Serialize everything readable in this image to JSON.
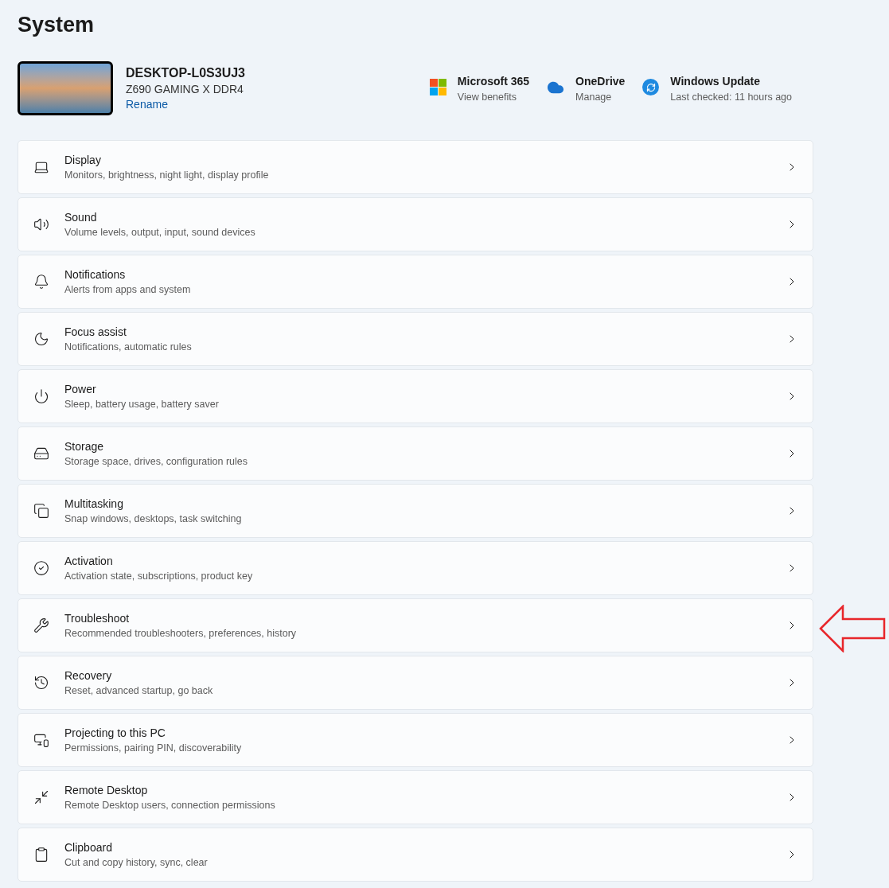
{
  "page_title": "System",
  "device": {
    "name": "DESKTOP-L0S3UJ3",
    "model": "Z690 GAMING X DDR4",
    "rename_link": "Rename"
  },
  "services": [
    {
      "kind": "microsoft365",
      "title": "Microsoft 365",
      "subtitle": "View benefits"
    },
    {
      "kind": "onedrive",
      "title": "OneDrive",
      "subtitle": "Manage"
    },
    {
      "kind": "update",
      "title": "Windows Update",
      "subtitle": "Last checked: 11 hours ago"
    }
  ],
  "settings": [
    {
      "kind": "display",
      "title": "Display",
      "subtitle": "Monitors, brightness, night light, display profile"
    },
    {
      "kind": "sound",
      "title": "Sound",
      "subtitle": "Volume levels, output, input, sound devices"
    },
    {
      "kind": "notifications",
      "title": "Notifications",
      "subtitle": "Alerts from apps and system"
    },
    {
      "kind": "focus",
      "title": "Focus assist",
      "subtitle": "Notifications, automatic rules"
    },
    {
      "kind": "power",
      "title": "Power",
      "subtitle": "Sleep, battery usage, battery saver"
    },
    {
      "kind": "storage",
      "title": "Storage",
      "subtitle": "Storage space, drives, configuration rules"
    },
    {
      "kind": "multitasking",
      "title": "Multitasking",
      "subtitle": "Snap windows, desktops, task switching"
    },
    {
      "kind": "activation",
      "title": "Activation",
      "subtitle": "Activation state, subscriptions, product key"
    },
    {
      "kind": "troubleshoot",
      "title": "Troubleshoot",
      "subtitle": "Recommended troubleshooters, preferences, history"
    },
    {
      "kind": "recovery",
      "title": "Recovery",
      "subtitle": "Reset, advanced startup, go back"
    },
    {
      "kind": "projecting",
      "title": "Projecting to this PC",
      "subtitle": "Permissions, pairing PIN, discoverability"
    },
    {
      "kind": "remote",
      "title": "Remote Desktop",
      "subtitle": "Remote Desktop users, connection permissions"
    },
    {
      "kind": "clipboard",
      "title": "Clipboard",
      "subtitle": "Cut and copy history, sync, clear"
    }
  ]
}
